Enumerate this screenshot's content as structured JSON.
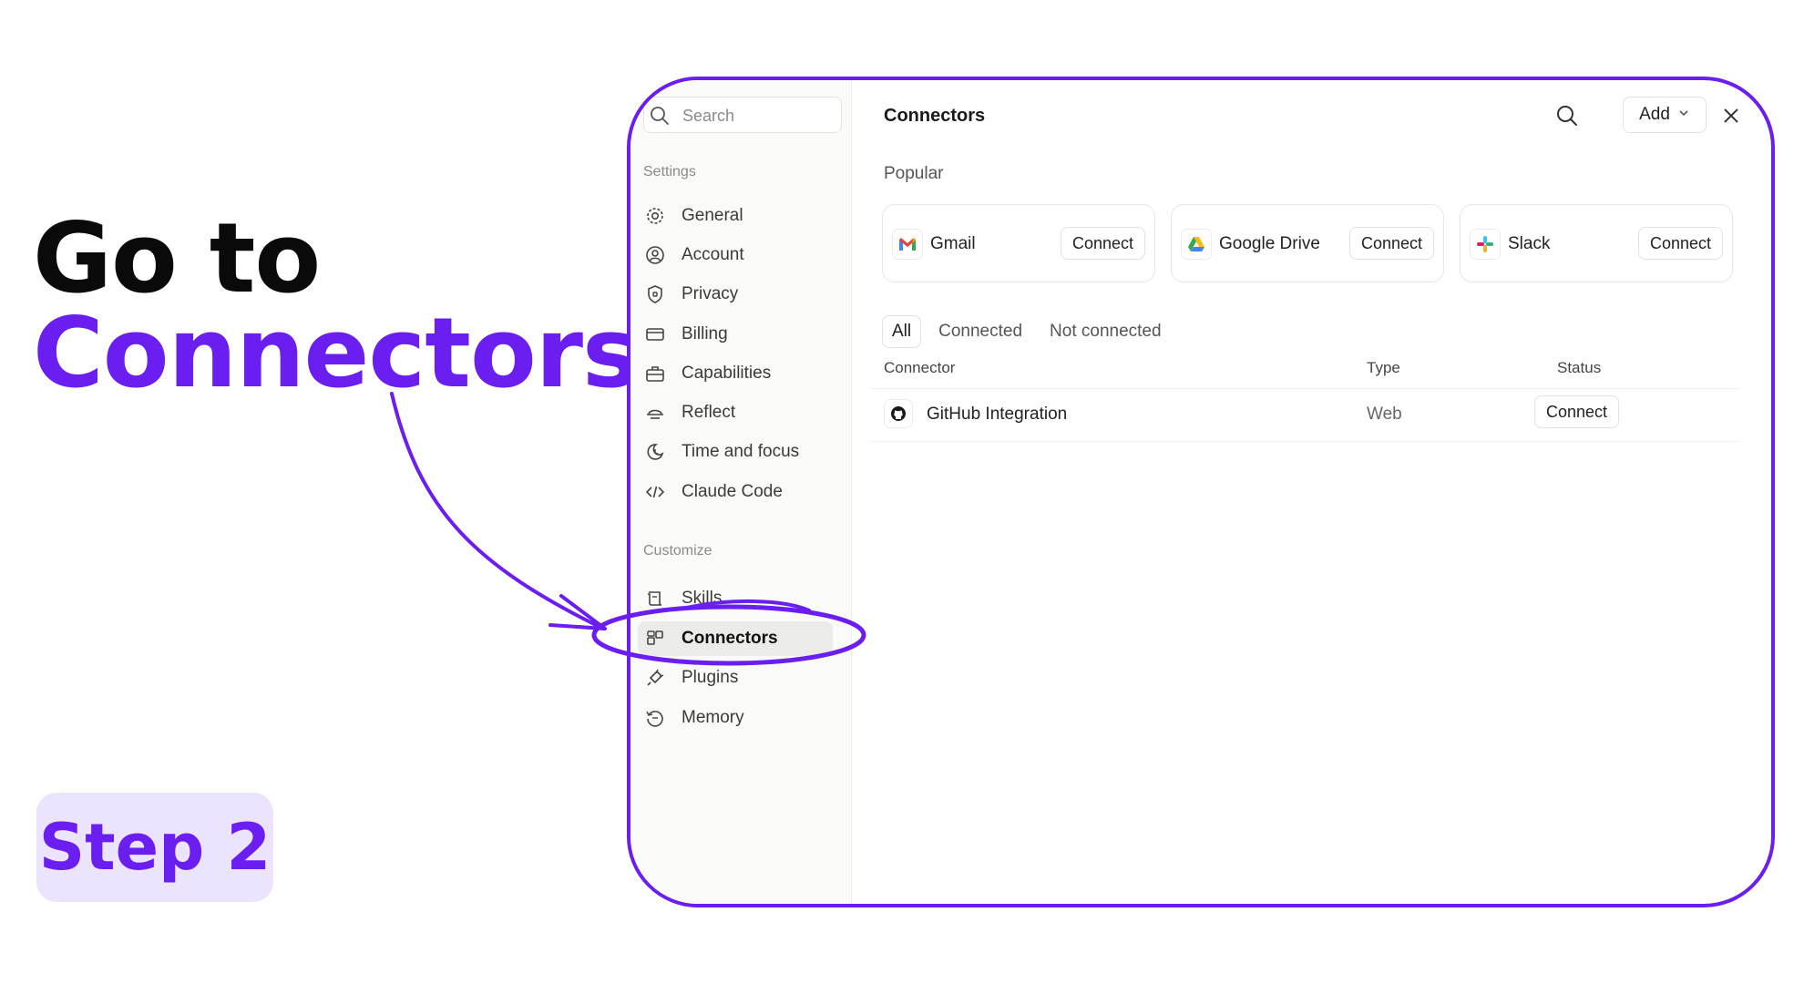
{
  "headline": {
    "line1": "Go to",
    "line2": "Connectors"
  },
  "step_badge": "Step 2",
  "colors": {
    "accent": "#6a1ff0",
    "badge_bg": "#ece3ff"
  },
  "sidebar": {
    "search_placeholder": "Search",
    "settings_label": "Settings",
    "settings_items": [
      {
        "label": "General",
        "icon": "gear-icon"
      },
      {
        "label": "Account",
        "icon": "user-circle-icon"
      },
      {
        "label": "Privacy",
        "icon": "shield-icon"
      },
      {
        "label": "Billing",
        "icon": "credit-card-icon"
      },
      {
        "label": "Capabilities",
        "icon": "briefcase-icon"
      },
      {
        "label": "Reflect",
        "icon": "reflect-icon"
      },
      {
        "label": "Time and focus",
        "icon": "moon-clock-icon"
      },
      {
        "label": "Claude Code",
        "icon": "code-icon"
      }
    ],
    "customize_label": "Customize",
    "customize_items": [
      {
        "label": "Skills",
        "icon": "scroll-icon"
      },
      {
        "label": "Connectors",
        "icon": "connectors-icon",
        "active": true
      },
      {
        "label": "Plugins",
        "icon": "plug-icon"
      },
      {
        "label": "Memory",
        "icon": "history-icon"
      }
    ]
  },
  "main": {
    "title": "Connectors",
    "add_label": "Add",
    "popular_label": "Popular",
    "popular": [
      {
        "name": "Gmail",
        "action": "Connect"
      },
      {
        "name": "Google Drive",
        "action": "Connect"
      },
      {
        "name": "Slack",
        "action": "Connect"
      }
    ],
    "filters": [
      "All",
      "Connected",
      "Not connected"
    ],
    "columns": {
      "connector": "Connector",
      "type": "Type",
      "status": "Status"
    },
    "rows": [
      {
        "name": "GitHub Integration",
        "type": "Web",
        "action": "Connect"
      }
    ]
  }
}
